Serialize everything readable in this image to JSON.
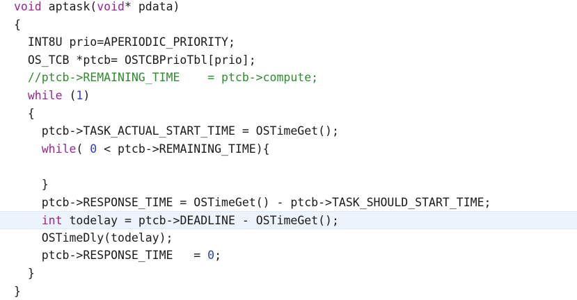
{
  "editor": {
    "colors": {
      "keyword": "#9b2393",
      "comment": "#2f8b2f",
      "number": "#2d3dc8",
      "text": "#1a1a1a",
      "current_line": "#ebf3fc"
    },
    "current_line_index": 12,
    "lines": [
      [
        {
          "t": "kw",
          "v": "void"
        },
        {
          "t": "tx",
          "v": " aptask("
        },
        {
          "t": "kw",
          "v": "void"
        },
        {
          "t": "tx",
          "v": "* pdata)"
        }
      ],
      [
        {
          "t": "tx",
          "v": "{"
        }
      ],
      [
        {
          "t": "tx",
          "v": "  INT8U prio=APERIODIC_PRIORITY;"
        }
      ],
      [
        {
          "t": "tx",
          "v": "  OS_TCB *ptcb= OSTCBPrioTbl[prio];"
        }
      ],
      [
        {
          "t": "cm",
          "v": "  //ptcb->REMAINING_TIME    = ptcb->compute;"
        }
      ],
      [
        {
          "t": "tx",
          "v": "  "
        },
        {
          "t": "kw",
          "v": "while"
        },
        {
          "t": "tx",
          "v": " ("
        },
        {
          "t": "num",
          "v": "1"
        },
        {
          "t": "tx",
          "v": ")"
        }
      ],
      [
        {
          "t": "tx",
          "v": "  {"
        }
      ],
      [
        {
          "t": "tx",
          "v": "    ptcb->TASK_ACTUAL_START_TIME = OSTimeGet();"
        }
      ],
      [
        {
          "t": "tx",
          "v": "    "
        },
        {
          "t": "kw",
          "v": "while"
        },
        {
          "t": "tx",
          "v": "( "
        },
        {
          "t": "num",
          "v": "0"
        },
        {
          "t": "tx",
          "v": " < ptcb->REMAINING_TIME){"
        }
      ],
      [
        {
          "t": "tx",
          "v": ""
        }
      ],
      [
        {
          "t": "tx",
          "v": "    }"
        }
      ],
      [
        {
          "t": "tx",
          "v": "    ptcb->RESPONSE_TIME = OSTimeGet() - ptcb->TASK_SHOULD_START_TIME;"
        }
      ],
      [
        {
          "t": "tx",
          "v": "    "
        },
        {
          "t": "kw",
          "v": "int"
        },
        {
          "t": "tx",
          "v": " todelay = ptcb->DEADLINE - OSTimeGet();"
        }
      ],
      [
        {
          "t": "tx",
          "v": "    OSTimeDly(todelay);"
        }
      ],
      [
        {
          "t": "tx",
          "v": "    ptcb->RESPONSE_TIME   = "
        },
        {
          "t": "num",
          "v": "0"
        },
        {
          "t": "tx",
          "v": ";"
        }
      ],
      [
        {
          "t": "tx",
          "v": "  }"
        }
      ],
      [
        {
          "t": "tx",
          "v": "}"
        }
      ]
    ]
  }
}
